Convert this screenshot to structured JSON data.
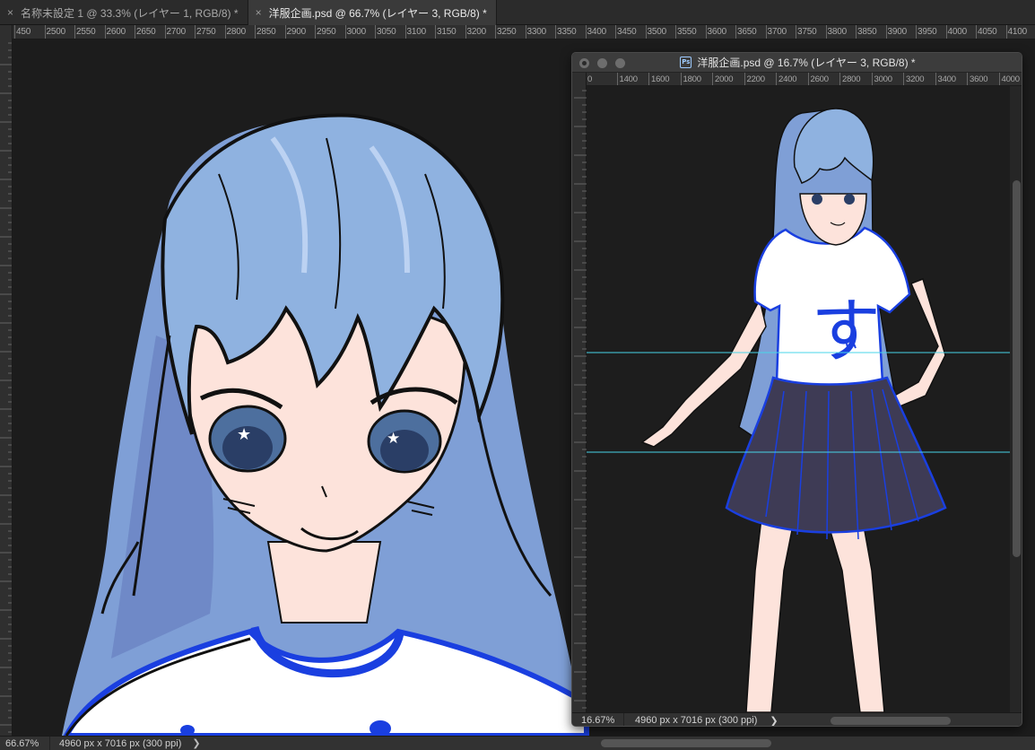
{
  "tabs": [
    {
      "close": "×",
      "label": "名称未設定 1 @ 33.3% (レイヤー 1, RGB/8) *",
      "active": false
    },
    {
      "close": "×",
      "label": "洋服企画.psd @ 66.7% (レイヤー 3, RGB/8) *",
      "active": true
    }
  ],
  "main_ruler_labels": [
    "450",
    "2500",
    "2550",
    "2600",
    "2650",
    "2700",
    "2750",
    "2800",
    "2850",
    "2900",
    "2950",
    "3000",
    "3050",
    "3100",
    "3150",
    "3200",
    "3250",
    "3300",
    "3350",
    "3400",
    "3450",
    "3500",
    "3550",
    "3600",
    "3650",
    "3700",
    "3750",
    "3800",
    "3850",
    "3900",
    "3950",
    "4000",
    "4050",
    "4100",
    "41"
  ],
  "main_status": {
    "zoom": "66.67%",
    "doc_info": "4960 px x 7016 px (300 ppi)",
    "arrow": "❯"
  },
  "float_window": {
    "title": "洋服企画.psd @ 16.7% (レイヤー 3, RGB/8) *",
    "app_icon": "Ps",
    "ruler_labels": [
      "0",
      "1400",
      "1600",
      "1800",
      "2000",
      "2200",
      "2400",
      "2600",
      "2800",
      "3000",
      "3200",
      "3400",
      "3600",
      "4000"
    ],
    "status": {
      "zoom": "16.67%",
      "doc_info": "4960 px x 7016 px (300 ppi)",
      "arrow": "❯"
    },
    "shirt_text": "す",
    "guides": 2
  },
  "colors": {
    "hair": "#8fb2e0",
    "hair_shadow": "#7490c9",
    "skin": "#fde3db",
    "outline_blue": "#1a3fe0",
    "skirt": "#3e3b55",
    "guide": "#48d4e8"
  }
}
